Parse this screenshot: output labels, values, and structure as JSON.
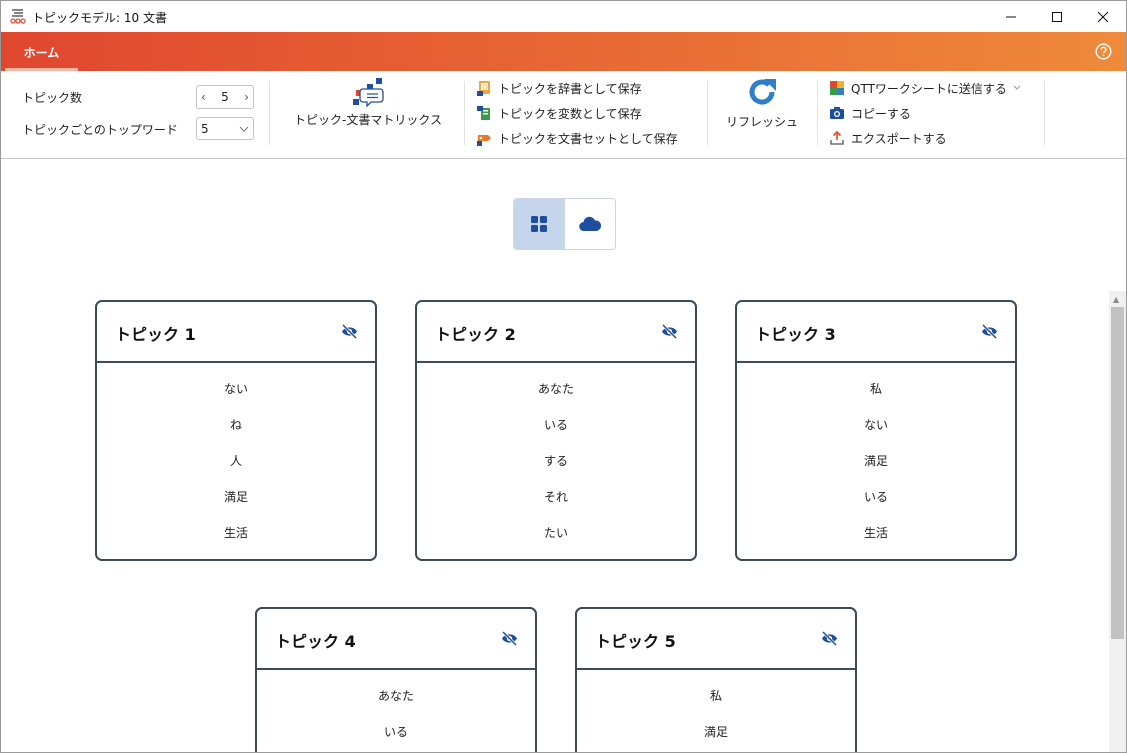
{
  "window": {
    "title": "トピックモデル: 10 文書",
    "minimize_icon": "minimize-icon",
    "maximize_icon": "maximize-icon",
    "close_icon": "close-icon"
  },
  "ribbon_tabs": {
    "home_label": "ホーム",
    "help_icon": "help-icon",
    "gradient_start": "#e0472f",
    "gradient_end": "#ef8a3b"
  },
  "ribbon": {
    "topic_count_label": "トピック数",
    "topic_count_value": "5",
    "top_words_label": "トピックごとのトップワード",
    "top_words_value": "5",
    "matrix_button": "トピック-文書マトリックス",
    "save_dictionary": "トピックを辞書として保存",
    "save_variable": "トピックを変数として保存",
    "save_document_set": "トピックを文書セットとして保存",
    "refresh": "リフレッシュ",
    "send_worksheet": "QTTワークシートに送信する",
    "copy": "コピーする",
    "export": "エクスポートする"
  },
  "view_toggle": {
    "grid_icon": "grid-icon",
    "cloud_icon": "cloud-icon",
    "active": "grid",
    "active_color": "#c5d5ec",
    "icon_color": "#1f4e9e"
  },
  "topics": [
    {
      "title": "トピック 1",
      "words": [
        "ない",
        "ね",
        "人",
        "満足",
        "生活"
      ]
    },
    {
      "title": "トピック 2",
      "words": [
        "あなた",
        "いる",
        "する",
        "それ",
        "たい"
      ]
    },
    {
      "title": "トピック 3",
      "words": [
        "私",
        "ない",
        "満足",
        "いる",
        "生活"
      ]
    },
    {
      "title": "トピック 4",
      "words": [
        "あなた",
        "いる"
      ]
    },
    {
      "title": "トピック 5",
      "words": [
        "私",
        "満足"
      ]
    }
  ]
}
